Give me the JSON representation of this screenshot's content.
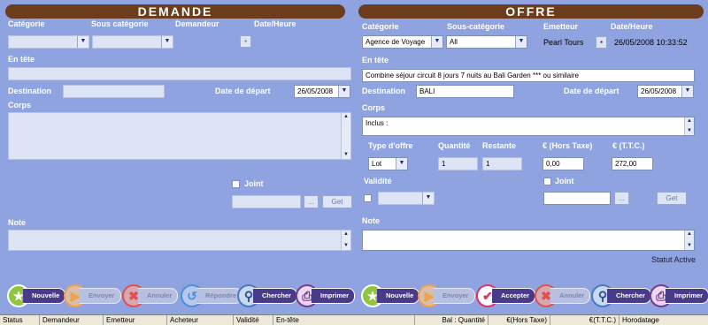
{
  "demande": {
    "title": "DEMANDE",
    "categorie_label": "Catégorie",
    "sous_categorie_label": "Sous catégorie",
    "demandeur_label": "Demandeur",
    "date_heure_label": "Date/Heure",
    "en_tete_label": "En tête",
    "destination_label": "Destination",
    "date_depart_label": "Date de départ",
    "date_depart_value": "26/05/2008",
    "corps_label": "Corps",
    "joint_label": "Joint",
    "get_label": "Get",
    "browse_label": "...",
    "note_label": "Note"
  },
  "offre": {
    "title": "OFFRE",
    "categorie_label": "Catégorie",
    "categorie_value": "Agence de Voyage",
    "sous_categorie_label": "Sous-catégorie",
    "sous_categorie_value": "All",
    "emetteur_label": "Emetteur",
    "emetteur_value": "Pearl Tours",
    "date_heure_label": "Date/Heure",
    "date_heure_value": "26/05/2008 10:33:52",
    "en_tete_label": "En tête",
    "en_tete_value": "Combine séjour circuit 8 jours 7 nuits  au Bali Garden *** ou similaire",
    "destination_label": "Destination",
    "destination_value": "BALI",
    "date_depart_label": "Date de départ",
    "date_depart_value": "26/05/2008",
    "corps_label": "Corps",
    "corps_value": "Inclus :",
    "type_offre_label": "Type d'offre",
    "type_offre_value": "Lot",
    "quantite_label": "Quantité",
    "quantite_value": "1",
    "restante_label": "Restante",
    "restante_value": "1",
    "ht_label": "€ (Hors Taxe)",
    "ht_value": "0,00",
    "ttc_label": "€ (T.T.C.)",
    "ttc_value": "272,00",
    "validite_label": "Validité",
    "joint_label": "Joint",
    "get_label": "Get",
    "browse_label": "...",
    "note_label": "Note",
    "status_text": "Statut Active"
  },
  "toolbar_left": [
    {
      "label": "Nouvelle",
      "icon": "star-icon",
      "color": "#8ec63f"
    },
    {
      "label": "Envoyer",
      "icon": "play-icon",
      "color": "#f0a050"
    },
    {
      "label": "Annuler",
      "icon": "x-icon",
      "color": "#e05050"
    },
    {
      "label": "Répondre",
      "icon": "reply-icon",
      "color": "#4a90e2"
    },
    {
      "label": "Chercher",
      "icon": "magnifier-icon",
      "color": "#4a7ac0"
    },
    {
      "label": "Imprimer",
      "icon": "printer-icon",
      "color": "#7a3a8a"
    }
  ],
  "toolbar_right": [
    {
      "label": "Nouvelle",
      "icon": "star-icon",
      "color": "#8ec63f"
    },
    {
      "label": "Envoyer",
      "icon": "play-icon",
      "color": "#f0a050"
    },
    {
      "label": "Accepter",
      "icon": "check-icon",
      "color": "#e0306a"
    },
    {
      "label": "Annuler",
      "icon": "x-icon",
      "color": "#e05050"
    },
    {
      "label": "Chercher",
      "icon": "magnifier-icon",
      "color": "#4a7ac0"
    },
    {
      "label": "Imprimer",
      "icon": "printer-icon",
      "color": "#7a3a8a"
    }
  ],
  "statusbar": [
    "Status",
    "Demandeur",
    "Emetteur",
    "Acheteur",
    "Validité",
    "En-tête",
    "Bal : Quantité",
    "€(Hors Taxe)",
    "€(T.T.C.)",
    "Horodatage"
  ]
}
